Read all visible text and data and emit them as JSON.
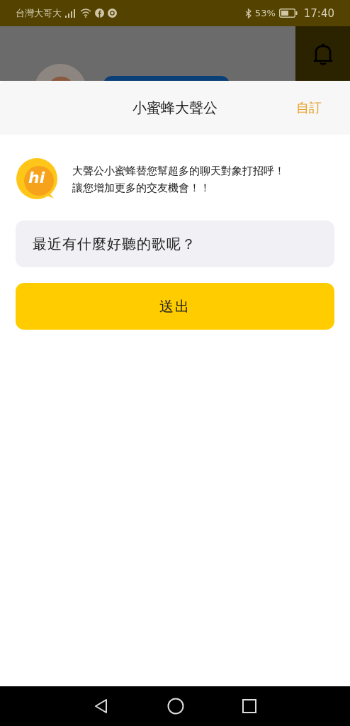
{
  "status_bar": {
    "carrier": "台灣大哥大",
    "battery": "53%",
    "time": "17:40"
  },
  "sheet": {
    "title": "小蜜蜂大聲公",
    "action": "自訂",
    "logo_text": "hi",
    "intro_lines": [
      "大聲公小蜜蜂替您幫超多的聊天對象打招呼！",
      "讓您增加更多的交友機會！！"
    ],
    "message": {
      "value": "最近有什麼好聽的歌呢？"
    },
    "submit": "送出"
  }
}
